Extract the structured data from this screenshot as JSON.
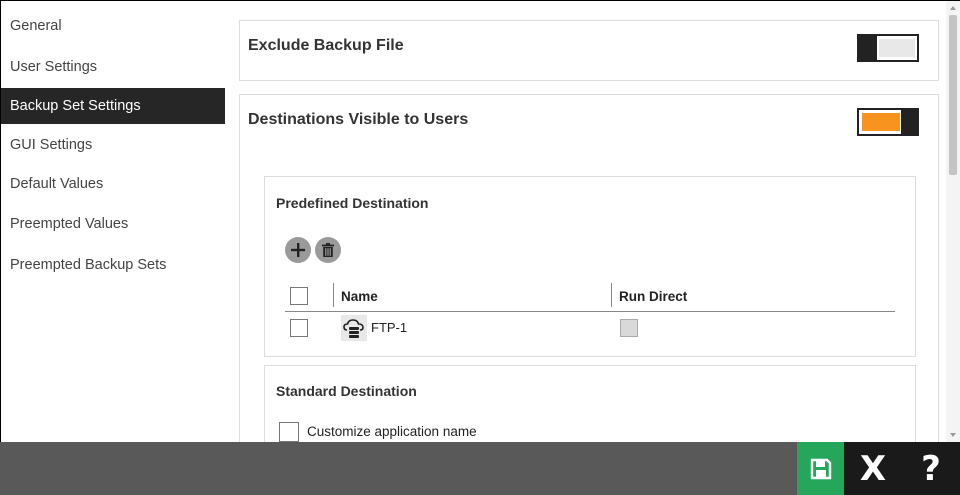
{
  "sidebar": {
    "items": [
      {
        "label": "General",
        "active": false
      },
      {
        "label": "User Settings",
        "active": false
      },
      {
        "label": "Backup Set Settings",
        "active": true
      },
      {
        "label": "GUI Settings",
        "active": false
      },
      {
        "label": "Default Values",
        "active": false
      },
      {
        "label": "Preempted Values",
        "active": false
      },
      {
        "label": "Preempted Backup Sets",
        "active": false
      }
    ]
  },
  "main": {
    "exclude_backup_file": {
      "title": "Exclude Backup File",
      "toggle_on": false
    },
    "destinations_visible": {
      "title": "Destinations Visible to Users",
      "toggle_on": true
    },
    "predefined_destination": {
      "title": "Predefined Destination",
      "columns": [
        "Name",
        "Run Direct"
      ],
      "rows": [
        {
          "name": "FTP-1",
          "icon": "cloud-server-icon",
          "run_direct": false
        }
      ]
    },
    "standard_destination": {
      "title": "Standard Destination",
      "customize_label": "Customize application name"
    }
  },
  "bottom_bar": {
    "save_icon": "save-icon",
    "close_label": "X",
    "help_label": "?"
  },
  "colors": {
    "accent_orange": "#f7931e",
    "save_green": "#26a65b",
    "sidebar_active": "#262626",
    "bottom_bar": "#595959"
  }
}
